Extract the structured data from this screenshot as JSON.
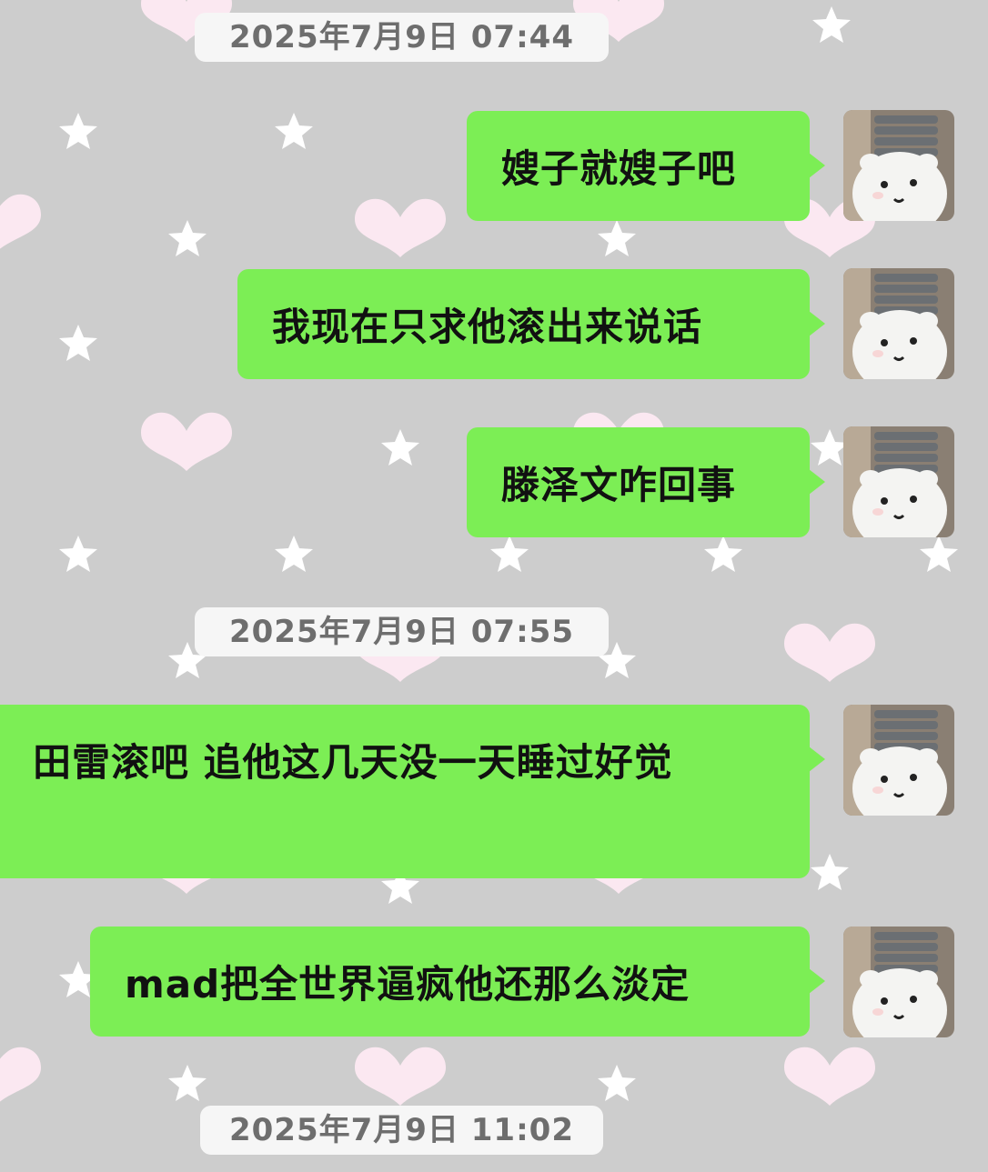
{
  "theme": {
    "background": "#cdcdcd",
    "bubble_color": "#7cee55",
    "timestamp_bg": "#f6f6f6",
    "decor_heart": "#fbe8f1",
    "decor_star": "#ffffff"
  },
  "chat": {
    "timestamps": [
      "2025年7月9日 07:44",
      "2025年7月9日 07:55",
      "2025年7月9日 11:02"
    ],
    "messages": [
      {
        "text": "嫂子就嫂子吧",
        "sender": "self",
        "avatar": "avatar-bear-icon"
      },
      {
        "text": "我现在只求他滚出来说话",
        "sender": "self",
        "avatar": "avatar-bear-icon"
      },
      {
        "text": "滕泽文咋回事",
        "sender": "self",
        "avatar": "avatar-bear-icon"
      },
      {
        "text": "田雷滚吧 追他这几天没一天睡过好觉",
        "sender": "self",
        "avatar": "avatar-bear-icon"
      },
      {
        "text": "mad把全世界逼疯他还那么淡定",
        "sender": "self",
        "avatar": "avatar-bear-icon"
      }
    ]
  }
}
